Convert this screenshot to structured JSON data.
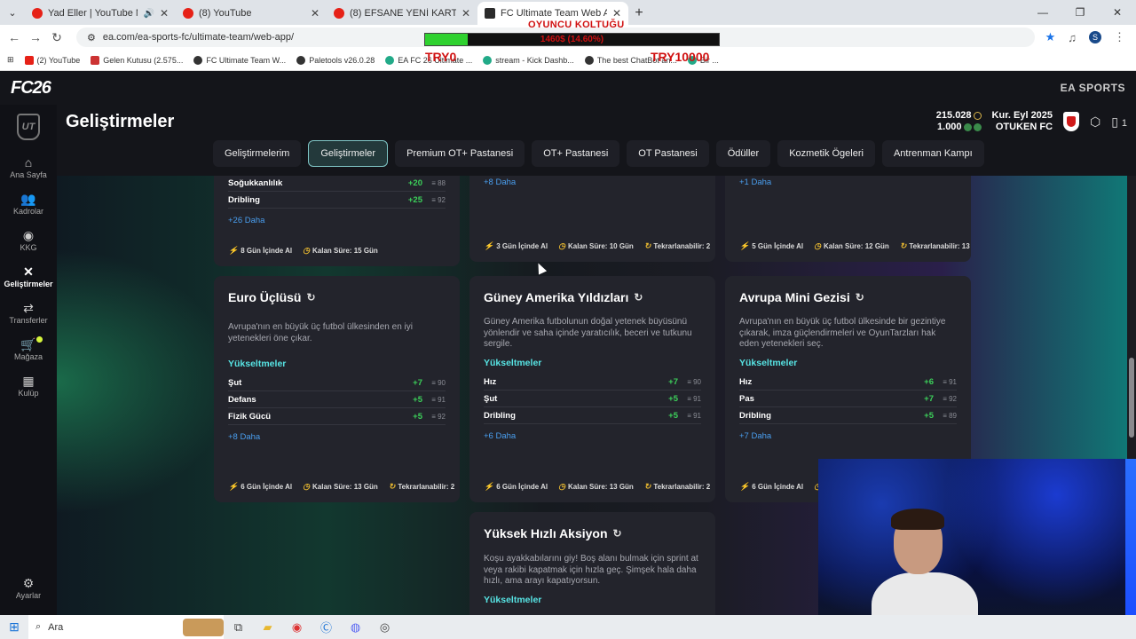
{
  "browser": {
    "tabs": [
      {
        "title": "Yad Eller | YouTube Music",
        "icon": "youtube-music-icon"
      },
      {
        "title": "(8) YouTube",
        "icon": "youtube-icon"
      },
      {
        "title": "(8) EFSANE YENİ KARTLARLA A",
        "icon": "youtube-icon"
      },
      {
        "title": "FC Ultimate Team Web App - E",
        "icon": "ea-icon"
      }
    ],
    "url": "ea.com/ea-sports-fc/ultimate-team/web-app/",
    "bookmarks": [
      "(2) YouTube",
      "Gelen Kutusu (2.575...",
      "FC Ultimate Team W...",
      "Paletools v26.0.28",
      "EA FC 26 Ultimate ...",
      "stream - Kick Dashb...",
      "The best ChatBot an...",
      "Bir ..."
    ],
    "profile_initial": "S"
  },
  "overlay": {
    "title": "OYUNCU KOLTUĞU",
    "bar_text": "1460$ (14.60%)",
    "progress": 0.146,
    "try_left": "TRY0",
    "try_right": "TRY10000"
  },
  "app": {
    "logo": "FC26",
    "brand": "EA SPORTS",
    "page_title": "Geliştirmeler",
    "coins": "215.028",
    "points": "1.000",
    "club_date": "Kur. Eyl 2025",
    "club_name": "OTUKEN FC",
    "notif_count": "1",
    "sidebar": [
      {
        "label": "Ana Sayfa",
        "icon": "home-icon"
      },
      {
        "label": "Kadrolar",
        "icon": "squad-icon"
      },
      {
        "label": "KKG",
        "icon": "sbc-icon"
      },
      {
        "label": "Geliştirmeler",
        "icon": "objectives-icon"
      },
      {
        "label": "Transferler",
        "icon": "transfer-icon"
      },
      {
        "label": "Mağaza",
        "icon": "store-icon"
      },
      {
        "label": "Kulüp",
        "icon": "club-icon"
      }
    ],
    "settings_label": "Ayarlar",
    "tabs": [
      "Geliştirmelerim",
      "Geliştirmeler",
      "Premium OT+ Pastanesi",
      "OT+ Pastanesi",
      "OT Pastanesi",
      "Ödüller",
      "Kozmetik Ögeleri",
      "Antrenman Kampı"
    ],
    "active_tab": "Geliştirmeler"
  },
  "cards_top": [
    {
      "rows": [
        {
          "name": "Soğukkanlılık",
          "plus": "+20",
          "max": "≡ 88"
        },
        {
          "name": "Dribling",
          "plus": "+25",
          "max": "≡ 92"
        }
      ],
      "more": "+26 Daha",
      "foot": {
        "days": "8 Gün İçinde Al",
        "remaining": "Kalan Süre: 15 Gün"
      }
    },
    {
      "more": "+8 Daha",
      "foot": {
        "days": "3 Gün İçinde Al",
        "remaining": "Kalan Süre: 10 Gün",
        "repeat": "Tekrarlanabilir: 2"
      }
    },
    {
      "more": "+1 Daha",
      "foot": {
        "days": "5 Gün İçinde Al",
        "remaining": "Kalan Süre: 12 Gün",
        "repeat": "Tekrarlanabilir: 13"
      }
    }
  ],
  "cards": [
    {
      "title": "Euro Üçlüsü",
      "desc": "Avrupa'nın en büyük üç futbol ülkesinden en iyi yetenekleri öne çıkar.",
      "section": "Yükseltmeler",
      "rows": [
        {
          "name": "Şut",
          "plus": "+7",
          "max": "≡ 90"
        },
        {
          "name": "Defans",
          "plus": "+5",
          "max": "≡ 91"
        },
        {
          "name": "Fizik Gücü",
          "plus": "+5",
          "max": "≡ 92"
        }
      ],
      "more": "+8 Daha",
      "foot": {
        "days": "6 Gün İçinde Al",
        "remaining": "Kalan Süre: 13 Gün",
        "repeat": "Tekrarlanabilir: 2"
      }
    },
    {
      "title": "Güney Amerika Yıldızları",
      "desc": "Güney Amerika futbolunun doğal yetenek büyüsünü yönlendir ve saha içinde yaratıcılık, beceri ve tutkunu sergile.",
      "section": "Yükseltmeler",
      "rows": [
        {
          "name": "Hız",
          "plus": "+7",
          "max": "≡ 90"
        },
        {
          "name": "Şut",
          "plus": "+5",
          "max": "≡ 91"
        },
        {
          "name": "Dribling",
          "plus": "+5",
          "max": "≡ 91"
        }
      ],
      "more": "+6 Daha",
      "foot": {
        "days": "6 Gün İçinde Al",
        "remaining": "Kalan Süre: 13 Gün",
        "repeat": "Tekrarlanabilir: 2"
      }
    },
    {
      "title": "Avrupa Mini Gezisi",
      "desc": "Avrupa'nın en büyük üç futbol ülkesinde bir gezintiye çıkarak, imza güçlendirmeleri ve OyunTarzları hak eden yetenekleri seç.",
      "section": "Yükseltmeler",
      "rows": [
        {
          "name": "Hız",
          "plus": "+6",
          "max": "≡ 91"
        },
        {
          "name": "Pas",
          "plus": "+7",
          "max": "≡ 92"
        },
        {
          "name": "Dribling",
          "plus": "+5",
          "max": "≡ 89"
        }
      ],
      "more": "+7 Daha",
      "foot": {
        "days": "6 Gün İçinde Al",
        "remaining": "Ka"
      }
    },
    {
      "title": "Yüksek Hızlı Aksiyon",
      "desc": "Koşu ayakkabılarını giy! Boş alanı bulmak için sprint at veya rakibi kapatmak için hızla geç. Şimşek hala daha hızlı, ama arayı kapatıyorsun.",
      "section": "Yükseltmeler"
    }
  ],
  "taskbar": {
    "search_placeholder": "Ara"
  }
}
